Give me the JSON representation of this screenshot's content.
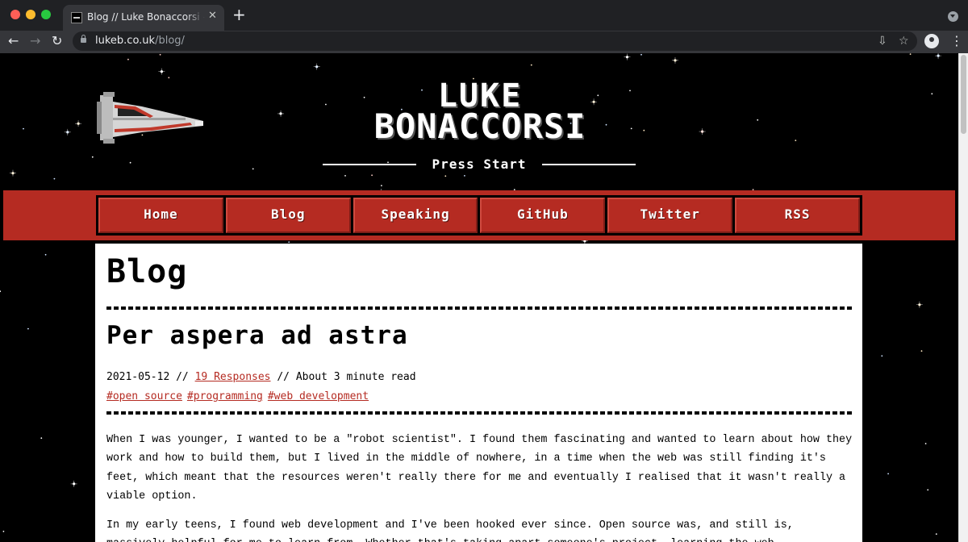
{
  "browser": {
    "tab_title": "Blog // Luke Bonaccorsi - Web",
    "tab_close": "✕",
    "new_tab": "+",
    "url_host": "lukeb.co.uk",
    "url_path": "/blog/",
    "back": "←",
    "forward": "→",
    "reload": "↻",
    "install": "⇩",
    "star": "☆",
    "menu": "⋮"
  },
  "site": {
    "title_line1": "LUKE",
    "title_line2": "BONACCORSI",
    "tagline": "Press Start"
  },
  "nav": {
    "items": [
      {
        "label": "Home"
      },
      {
        "label": "Blog"
      },
      {
        "label": "Speaking"
      },
      {
        "label": "GitHub"
      },
      {
        "label": "Twitter"
      },
      {
        "label": "RSS"
      }
    ]
  },
  "page": {
    "heading": "Blog"
  },
  "post": {
    "title": "Per aspera ad astra",
    "date": "2021-05-12",
    "sep1": " // ",
    "responses": "19 Responses",
    "sep2": " // ",
    "read_time": "About 3 minute read",
    "tags": [
      "#open source",
      "#programming",
      "#web development"
    ],
    "paragraph1": "When I was younger, I wanted to be a \"robot scientist\". I found them fascinating and wanted to learn about how they work and how to build them, but I lived in the middle of nowhere, in a time when the web was still finding it's feet, which meant that the resources weren't really there for me and eventually I realised that it wasn't really a viable option.",
    "paragraph2": "In my early teens, I found web development and I've been hooked ever since. Open source was, and still is, massively helpful for me to learn from. Whether that's taking apart someone's project, learning the web"
  },
  "colors": {
    "brand_red": "#b52b22",
    "background": "#000000",
    "content_bg": "#ffffff"
  }
}
